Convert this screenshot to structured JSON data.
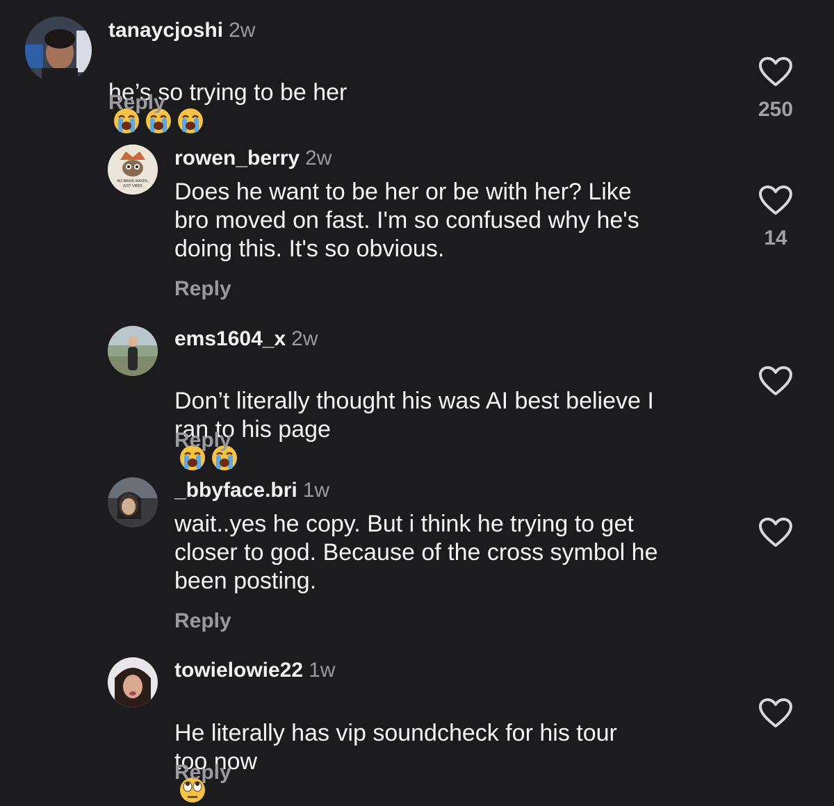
{
  "comments": [
    {
      "username": "tanaycjoshi",
      "time": "2w",
      "text": "he’s so trying to be her",
      "emojis": [
        "loudly-crying-face",
        "loudly-crying-face",
        "loudly-crying-face"
      ],
      "reply_label": "Reply",
      "likes": "250"
    },
    {
      "username": "rowen_berry",
      "time": "2w",
      "text": "Does he want to be her or be with her? Like\nbro moved on fast. I'm so confused why he's\ndoing this. It's so obvious.",
      "reply_label": "Reply",
      "likes": "14",
      "avatar_text_1": "NO BRAIN WAVES,",
      "avatar_text_2": "JUST VIBES"
    },
    {
      "username": "ems1604_x",
      "time": "2w",
      "text": "Don’t literally thought his was AI best believe I\nran to his page",
      "emojis": [
        "loudly-crying-face",
        "loudly-crying-face"
      ],
      "reply_label": "Reply"
    },
    {
      "username": "_bbyface.bri",
      "time": "1w",
      "text": "wait..yes he copy. But i think he trying to get\ncloser to god. Because of the cross symbol he\nbeen posting.",
      "reply_label": "Reply"
    },
    {
      "username": "towielowie22",
      "time": "1w",
      "text": "He literally has vip soundcheck for his tour\ntoo now",
      "emojis": [
        "face-with-rolling-eyes"
      ],
      "reply_label": "Reply"
    }
  ],
  "colors": {
    "background": "#1c1c1e",
    "text": "#f5f5f5",
    "muted": "#9a9aa0"
  }
}
